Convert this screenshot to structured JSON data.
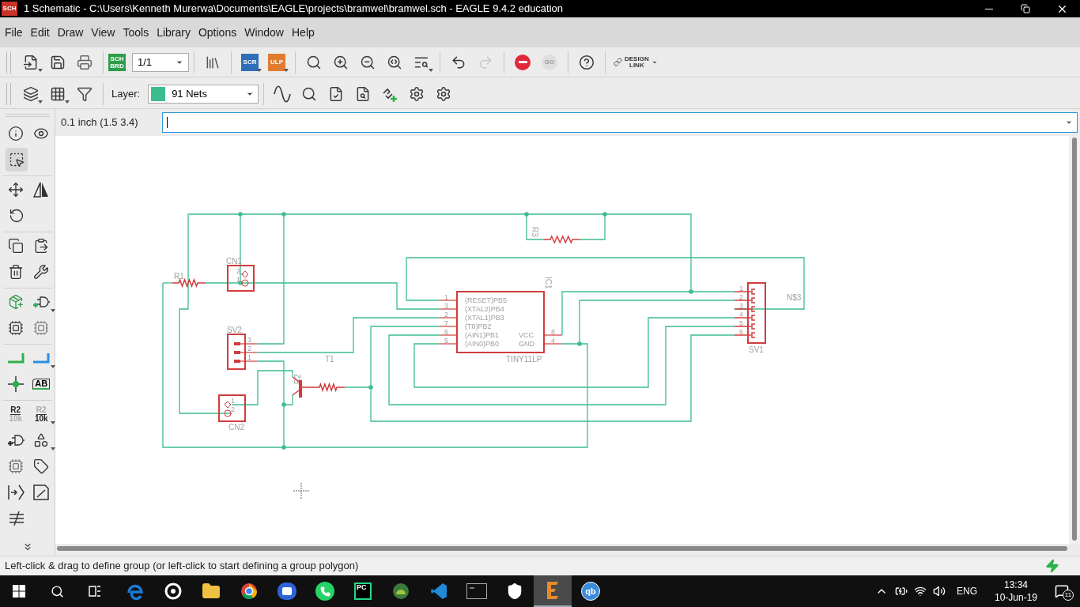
{
  "window": {
    "app_badge": "SCH",
    "title": "1 Schematic - C:\\Users\\Kenneth Murerwa\\Documents\\EAGLE\\projects\\bramwel\\bramwel.sch - EAGLE 9.4.2 education"
  },
  "menu": [
    "File",
    "Edit",
    "Draw",
    "View",
    "Tools",
    "Library",
    "Options",
    "Window",
    "Help"
  ],
  "toolbar": {
    "sch_brd": [
      "SCH",
      "BRD"
    ],
    "sheet": "1/1",
    "scr": "SCR",
    "ulp": "ULP",
    "redo": {
      "disabled": true
    },
    "go": {
      "label": "GO",
      "disabled": true
    },
    "design_link": [
      "DESIGN",
      "LINK"
    ]
  },
  "layer_bar": {
    "label": "Layer:",
    "layer": {
      "name": "91 Nets",
      "color": "#3dbd8e"
    }
  },
  "command": {
    "coordinates": "0.1 inch (1.5 3.4)"
  },
  "left_toolbar": {
    "tools": [
      {
        "selected": false
      },
      {
        "selected": false
      },
      {
        "selected": true
      },
      {
        "selected": false
      },
      {
        "selected": false
      },
      {
        "selected": false
      },
      {
        "selected": false
      },
      {
        "selected": false
      },
      {
        "selected": false
      },
      {
        "selected": false
      },
      {
        "selected": false
      },
      {
        "selected": false
      },
      {
        "selected": false
      },
      {
        "selected": false
      },
      {
        "selected": false
      },
      {
        "selected": false
      },
      {
        "selected": false
      },
      {
        "selected": false,
        "label": "AB"
      },
      {
        "selected": false,
        "lines": [
          "R2",
          "10k"
        ]
      },
      {
        "selected": false,
        "lines": [
          "R2",
          "10k"
        ]
      },
      {
        "selected": false
      },
      {
        "selected": false
      },
      {
        "selected": false
      },
      {
        "selected": false
      },
      {
        "selected": false
      },
      {
        "selected": false
      },
      {
        "selected": false
      }
    ]
  },
  "schematic": {
    "resistors": [
      "R1",
      "R2",
      "R3"
    ],
    "transistor": "T1",
    "cn1": {
      "name": "CN1",
      "pins": [
        "2",
        "1"
      ]
    },
    "sv2": {
      "name": "SV2",
      "pins": [
        "3",
        "2",
        "1"
      ]
    },
    "cn2": {
      "name": "CN2",
      "pins": [
        "1",
        "2"
      ]
    },
    "ic": {
      "name": "IC1",
      "value": "TINY11LP",
      "left_pins": [
        {
          "number": "1",
          "name": "(RESET)PB5"
        },
        {
          "number": "3",
          "name": "(XTAL2)PB4"
        },
        {
          "number": "2",
          "name": "(XTAL1)PB3"
        },
        {
          "number": "7",
          "name": "(T0)PB2"
        },
        {
          "number": "6",
          "name": "(AIN1)PB1"
        },
        {
          "number": "5",
          "name": "(AIN0)PB0"
        }
      ],
      "right_pins": [
        {
          "number": "8",
          "name": "VCC"
        },
        {
          "number": "4",
          "name": "GND"
        }
      ]
    },
    "sv1": {
      "name": "SV1",
      "pins": [
        "1",
        "2",
        "3",
        "4",
        "5",
        "6"
      ]
    },
    "net_label": "N$3"
  },
  "status_bar": {
    "message": "Left-click & drag to define group (or left-click to start defining a group polygon)"
  },
  "taskbar": {
    "apps": [
      {
        "active": false
      },
      {
        "active": false
      },
      {
        "active": false
      },
      {
        "active": false
      },
      {
        "active": false
      },
      {
        "active": false
      },
      {
        "active": false,
        "label": "PC"
      },
      {
        "active": false
      },
      {
        "active": false
      },
      {
        "active": false
      },
      {
        "active": false
      },
      {
        "active": true
      },
      {
        "active": false,
        "label": "qb"
      }
    ],
    "language": "ENG",
    "time": "13:34",
    "date": "10-Jun-19",
    "notifications": "11"
  }
}
